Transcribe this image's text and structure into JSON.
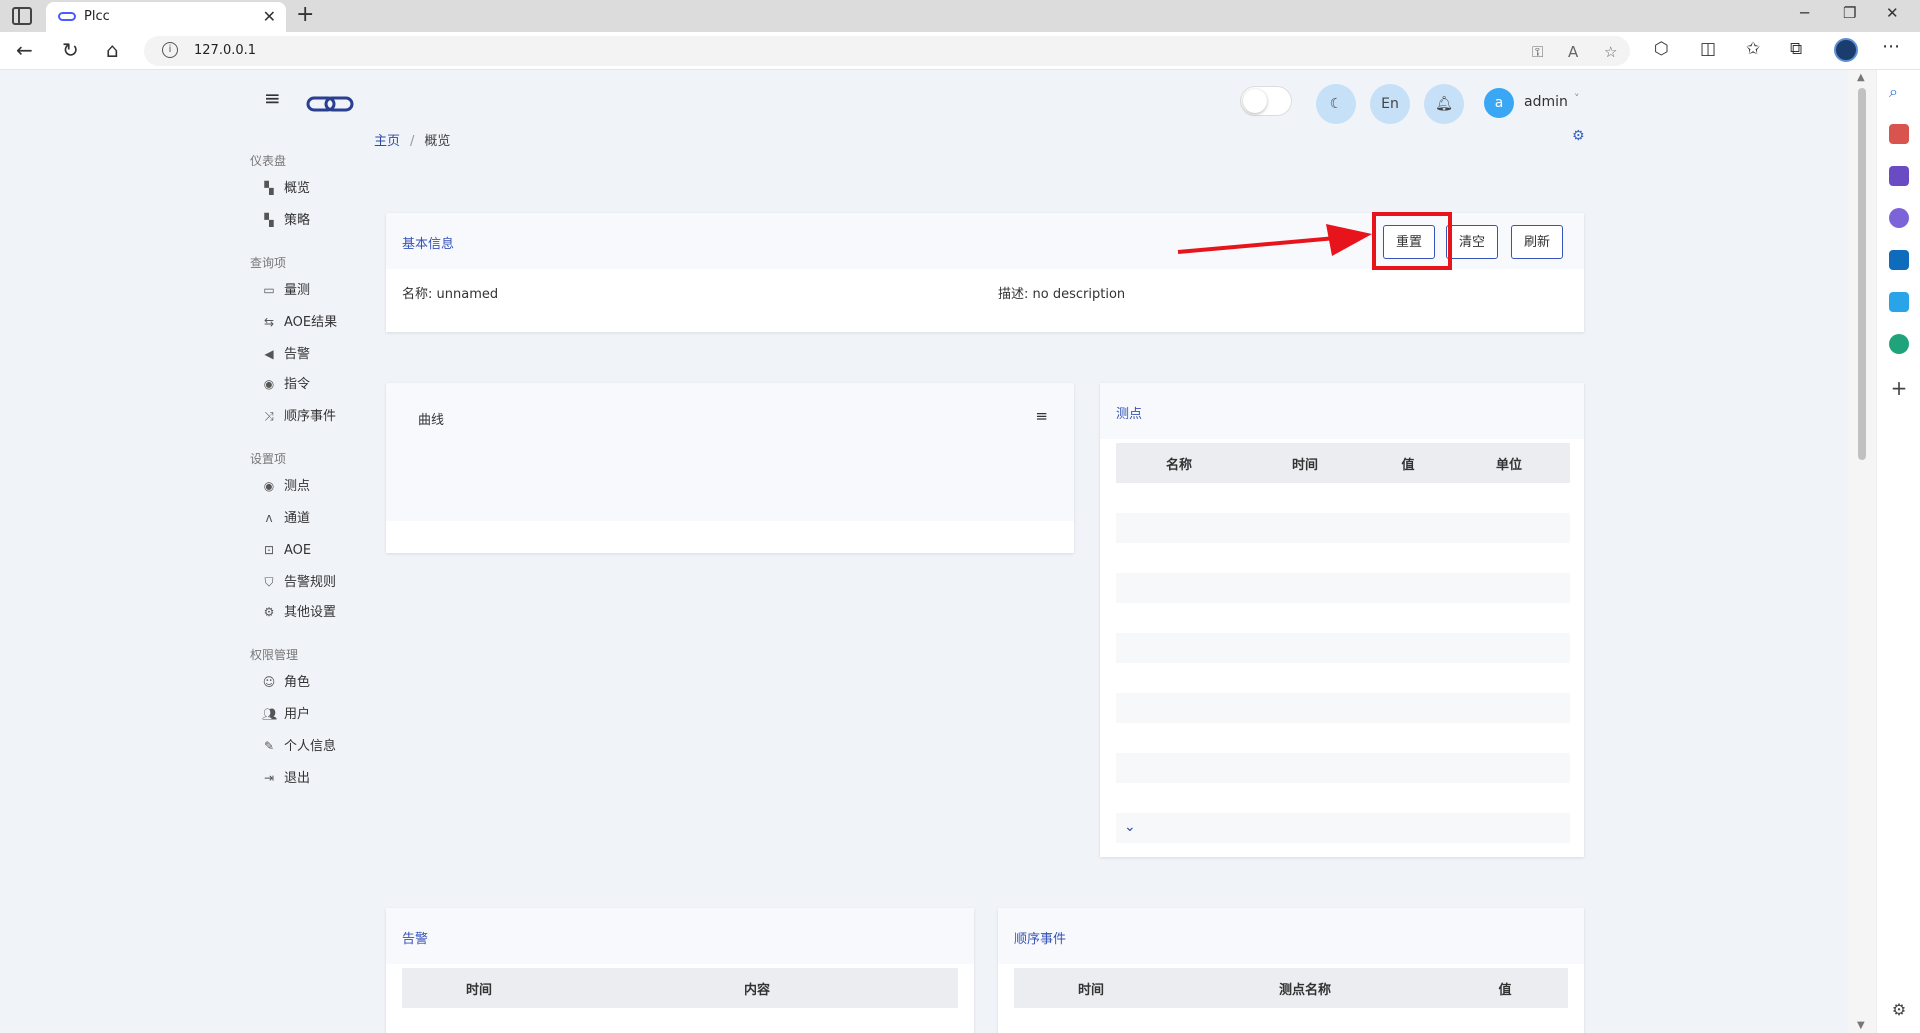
{
  "browser": {
    "tab_title": "Plcc",
    "url": "127.0.0.1"
  },
  "header": {
    "lang_button": "En",
    "user_avatar_letter": "a",
    "user_name": "admin"
  },
  "sidebar": {
    "sections": [
      {
        "label": "仪表盘",
        "items": [
          {
            "label": "概览",
            "icon": "dashboard-icon"
          },
          {
            "label": "策略",
            "icon": "dashboard-icon"
          }
        ]
      },
      {
        "label": "查询项",
        "items": [
          {
            "label": "量测",
            "icon": "monitor-icon"
          },
          {
            "label": "AOE结果",
            "icon": "refresh-icon"
          },
          {
            "label": "告警",
            "icon": "megaphone-icon"
          },
          {
            "label": "指令",
            "icon": "pin-icon"
          },
          {
            "label": "顺序事件",
            "icon": "shuffle-icon"
          }
        ]
      },
      {
        "label": "设置项",
        "items": [
          {
            "label": "测点",
            "icon": "pin-icon"
          },
          {
            "label": "通道",
            "icon": "channel-icon"
          },
          {
            "label": "AOE",
            "icon": "sitemap-icon"
          },
          {
            "label": "告警规则",
            "icon": "shield-icon"
          },
          {
            "label": "其他设置",
            "icon": "cogs-icon"
          }
        ]
      },
      {
        "label": "权限管理",
        "items": [
          {
            "label": "角色",
            "icon": "user-circle-icon"
          },
          {
            "label": "用户",
            "icon": "users-icon"
          },
          {
            "label": "个人信息",
            "icon": "edit-icon"
          },
          {
            "label": "退出",
            "icon": "logout-icon"
          }
        ]
      }
    ]
  },
  "breadcrumb": {
    "home": "主页",
    "separator": "/",
    "current": "概览"
  },
  "basic_info": {
    "title": "基本信息",
    "buttons": {
      "reset": "重置",
      "clear": "清空",
      "refresh": "刷新"
    },
    "name_label": "名称:",
    "name_value": "unnamed",
    "desc_label": "描述:",
    "desc_value": "no description"
  },
  "curve_card": {
    "title": "曲线"
  },
  "points_card": {
    "title": "测点",
    "columns": [
      "名称",
      "时间",
      "值",
      "单位"
    ]
  },
  "alarm_card": {
    "title": "告警",
    "columns": [
      "时间",
      "内容"
    ]
  },
  "soe_card": {
    "title": "顺序事件",
    "columns": [
      "时间",
      "测点名称",
      "值"
    ]
  },
  "colors": {
    "accent": "#3654b8",
    "highlight": "#e8141c",
    "page_bg": "#f0f3f8"
  }
}
